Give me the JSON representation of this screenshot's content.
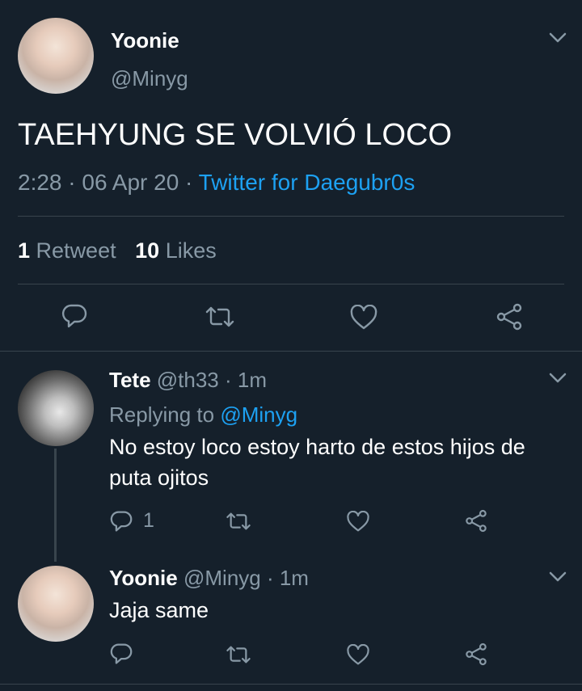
{
  "tweet": {
    "author_name": "Yoonie",
    "author_handle": "@Minyg",
    "text": "TAEHYUNG SE VOLVIÓ LOCO",
    "time": "2:28",
    "separator1": "·",
    "date": "06 Apr 20",
    "separator2": "·",
    "source": "Twitter for Daegubr0s",
    "retweet_count": "1",
    "retweet_label": "Retweet",
    "like_count": "10",
    "like_label": "Likes"
  },
  "replies": [
    {
      "author_name": "Tete",
      "author_handle": "@th33",
      "time": "· 1m",
      "replying_label": "Replying to",
      "replying_handle": "@Minyg",
      "text_line1": "No estoy loco estoy harto de estos hijos de",
      "text_line2": "puta ojitos",
      "reply_count": "1"
    },
    {
      "author_name": "Yoonie",
      "author_handle": "@Minyg",
      "time": "· 1m",
      "text": "Jaja same"
    }
  ],
  "icons": {
    "reply": "reply-icon",
    "retweet": "retweet-icon",
    "like": "heart-icon",
    "share": "share-icon",
    "more": "chevron-down-icon"
  },
  "colors": {
    "background": "#15202b",
    "text": "#ffffff",
    "muted": "#8899a6",
    "link": "#1da1f2",
    "divider": "#38444d"
  }
}
